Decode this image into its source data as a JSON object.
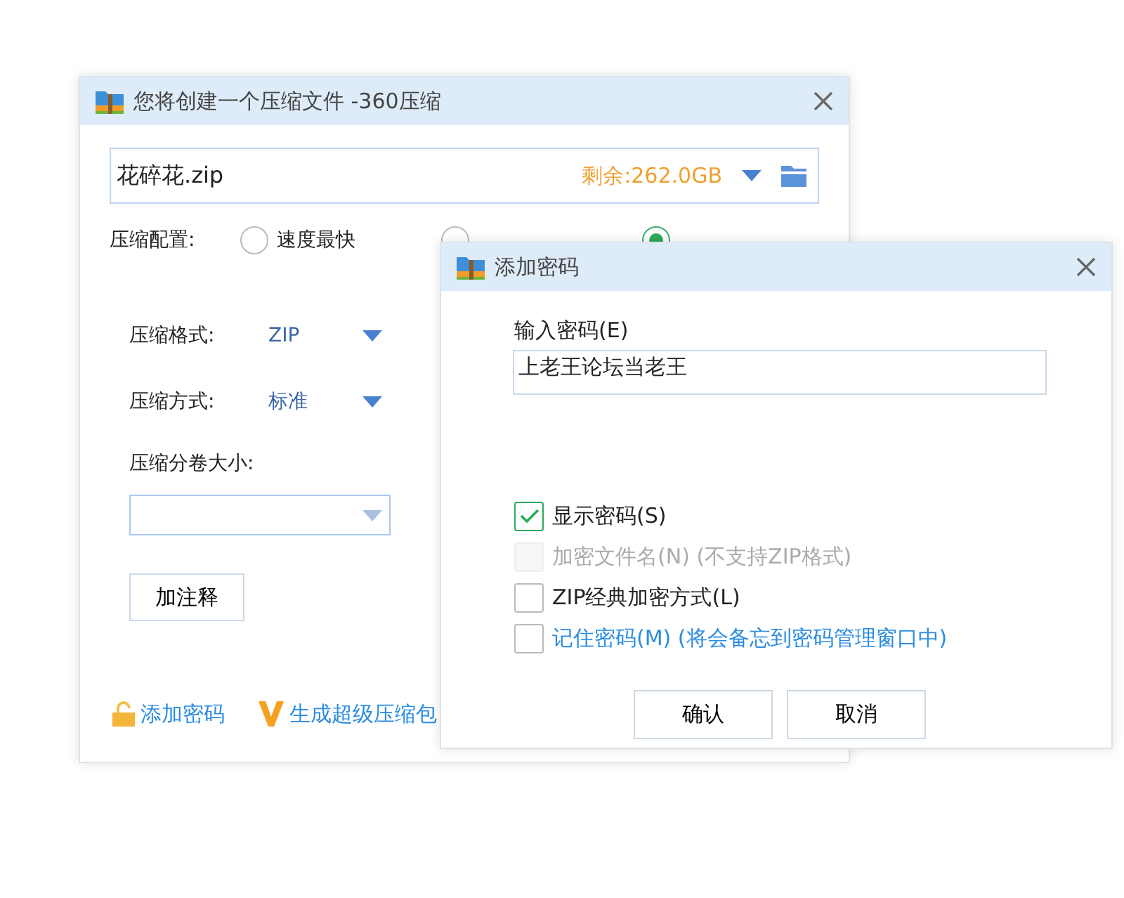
{
  "main_window": {
    "title": "您将创建一个压缩文件 -360压缩",
    "file_field": {
      "value": "花碎花.zip",
      "free_space": "剩余:262.0GB"
    },
    "config": {
      "label": "压缩配置:",
      "options": [
        {
          "label": "速度最快",
          "selected": false
        },
        {
          "selected": false
        },
        {
          "selected": true
        }
      ]
    },
    "settings": [
      {
        "label": "压缩格式:",
        "value": "ZIP"
      },
      {
        "label": "压缩方式:",
        "value": "标准"
      }
    ],
    "split": {
      "label": "压缩分卷大小:"
    },
    "comment_button": "加注释",
    "links": [
      {
        "kind": "lock",
        "label": "添加密码"
      },
      {
        "kind": "v",
        "label": "生成超级压缩包"
      }
    ]
  },
  "dialog": {
    "title": "添加密码",
    "password": {
      "label": "输入密码(E)",
      "value": "上老王论坛当老王"
    },
    "options": [
      {
        "label": "显示密码(S)",
        "checked": true,
        "disabled": false,
        "kind": "plain"
      },
      {
        "label": "加密文件名(N) (不支持ZIP格式)",
        "checked": false,
        "disabled": true,
        "kind": "plain"
      },
      {
        "label": "ZIP经典加密方式(L)",
        "checked": false,
        "disabled": false,
        "kind": "plain"
      },
      {
        "label": "记住密码(M) (将会备忘到密码管理窗口中)",
        "checked": false,
        "disabled": false,
        "kind": "link"
      }
    ],
    "buttons": [
      "确认",
      "取消"
    ]
  }
}
